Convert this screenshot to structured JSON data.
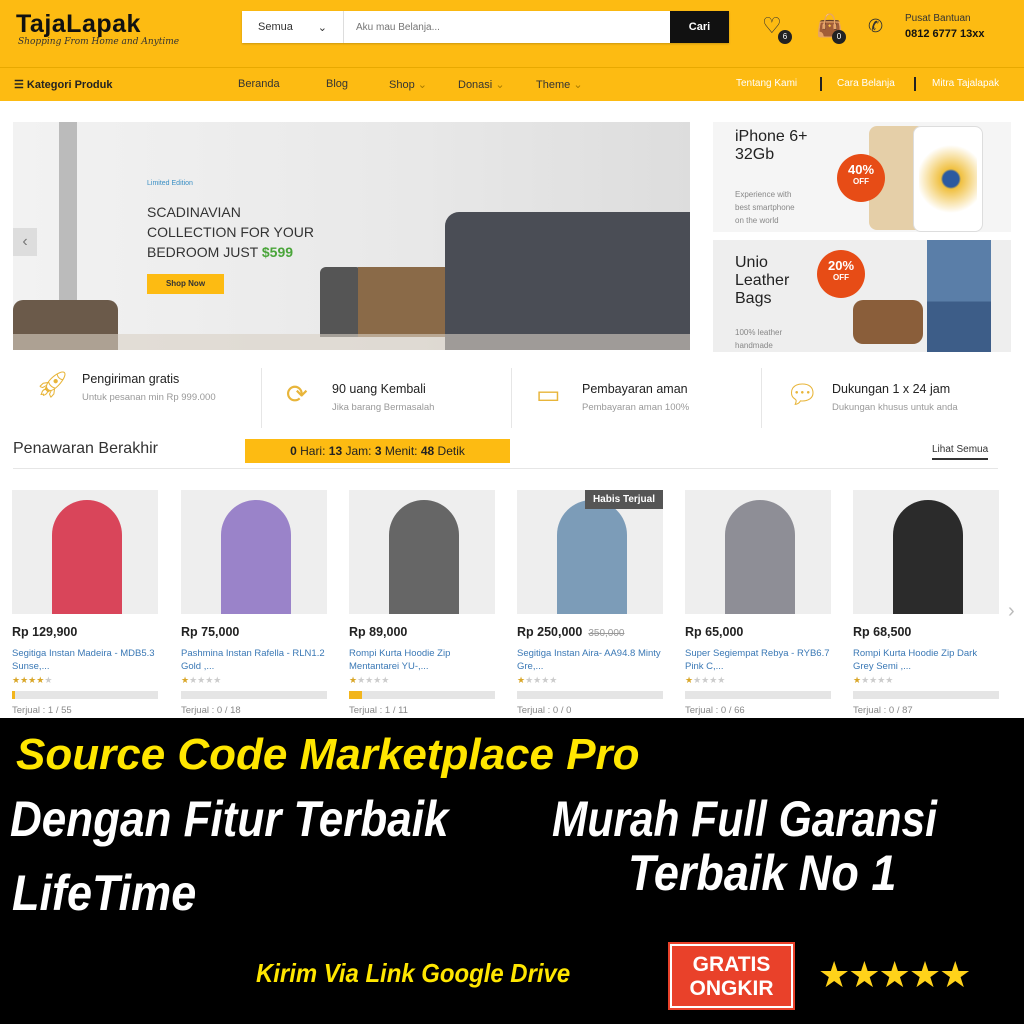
{
  "header": {
    "logo": "TajaLapak",
    "tagline": "Shopping From Home and Anytime",
    "search_category": "Semua",
    "search_placeholder": "Aku mau Belanja...",
    "search_button": "Cari",
    "wishlist_count": "6",
    "cart_count": "0",
    "help_label": "Pusat Bantuan",
    "help_phone": "0812 6777 13xx"
  },
  "nav": {
    "category": "Kategori Produk",
    "items": [
      "Beranda",
      "Blog",
      "Shop",
      "Donasi",
      "Theme"
    ],
    "right": [
      "Tentang Kami",
      "Cara Belanja",
      "Mitra Tajalapak"
    ]
  },
  "hero": {
    "small": "Limited Edition",
    "line1": "SCADINAVIAN",
    "line2": "COLLECTION FOR YOUR",
    "line3": "BEDROOM JUST ",
    "price": "$599",
    "button": "Shop Now"
  },
  "side1": {
    "title1": "iPhone 6+",
    "title2": "32Gb",
    "off": "40%",
    "off_label": "OFF",
    "desc": [
      "Experience with",
      "best smartphone",
      "on the world"
    ]
  },
  "side2": {
    "title": [
      "Unio",
      "Leather",
      "Bags"
    ],
    "off": "20%",
    "off_label": "OFF",
    "desc": [
      "100% leather",
      "handmade"
    ]
  },
  "features": [
    {
      "icon": "rocket-icon",
      "title": "Pengiriman gratis",
      "sub": "Untuk pesanan min Rp 999.000"
    },
    {
      "icon": "refresh-icon",
      "title": "90 uang Kembali",
      "sub": "Jika barang Bermasalah"
    },
    {
      "icon": "credit-card-icon",
      "title": "Pembayaran aman",
      "sub": "Pembayaran aman 100%"
    },
    {
      "icon": "chat-icon",
      "title": "Dukungan 1 x 24 jam",
      "sub": "Dukungan khusus untuk anda"
    }
  ],
  "deals": {
    "title": "Penawaran Berakhir",
    "days": "0",
    "days_l": " Hari: ",
    "hours": "13",
    "hours_l": " Jam: ",
    "mins": "3",
    "mins_l": " Menit: ",
    "secs": "48",
    "secs_l": " Detik",
    "see_all": "Lihat Semua"
  },
  "products": [
    {
      "price": "Rp 129,900",
      "name": "Segitiga Instan Madeira - MDB5.3 Sunse,...",
      "rating": 4,
      "sold": "Terjual : 1 / 55",
      "progress": 2,
      "color": "#d9455a"
    },
    {
      "price": "Rp 75,000",
      "name": "Pashmina Instan Rafella - RLN1.2 Gold ,...",
      "rating": 1,
      "sold": "Terjual : 0 / 18",
      "progress": 0,
      "color": "#9a83c9"
    },
    {
      "price": "Rp 89,000",
      "name": "Rompi Kurta Hoodie Zip Mentantarei YU-,...",
      "rating": 1,
      "sold": "Terjual : 1 / 11",
      "progress": 9,
      "color": "#666"
    },
    {
      "price": "Rp 250,000",
      "old": "350,000",
      "badge": "Habis Terjual",
      "name": "Segitiga Instan Aira- AA94.8 Minty Gre,...",
      "rating": 1,
      "sold": "Terjual : 0 / 0",
      "progress": 0,
      "color": "#7c9cb8"
    },
    {
      "price": "Rp 65,000",
      "name": "Super Segiempat Rebya - RYB6.7 Pink C,...",
      "rating": 1,
      "sold": "Terjual : 0 / 66",
      "progress": 0,
      "color": "#8e8e96"
    },
    {
      "price": "Rp 68,500",
      "name": "Rompi Kurta Hoodie Zip Dark Grey Semi ,...",
      "rating": 1,
      "sold": "Terjual : 0 / 87",
      "progress": 0,
      "color": "#2b2b2b"
    }
  ],
  "promo": {
    "headline": "Source Code Marketplace Pro",
    "left1": "Dengan Fitur Terbaik",
    "left2": "LifeTime",
    "right1": "Murah Full Garansi",
    "right2": "Terbaik No 1",
    "delivery": "Kirim Via Link Google Drive",
    "badge1": "GRATIS",
    "badge2": "ONGKIR",
    "stars": "★★★★★"
  },
  "colors": {
    "brand": "#fdbb12",
    "promo_yellow": "#ffe600",
    "badge_red": "#e9412a"
  }
}
